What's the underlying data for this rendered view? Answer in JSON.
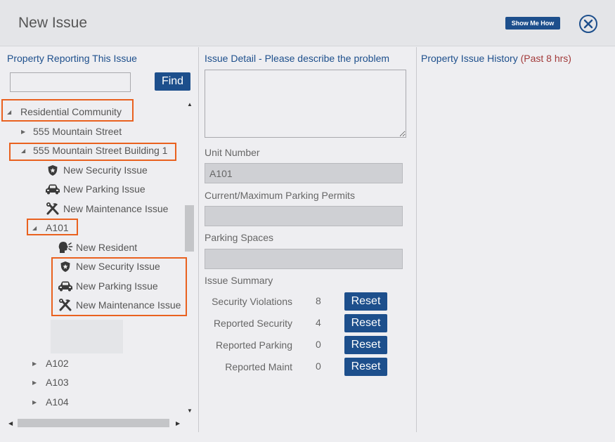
{
  "header": {
    "title": "New Issue",
    "show_me_how": "Show Me How"
  },
  "property_panel": {
    "heading": "Property Reporting This Issue",
    "search_value": "",
    "find_label": "Find",
    "tree": {
      "community": "Residential Community",
      "street": "555 Mountain Street",
      "building": "555 Mountain Street Building 1",
      "building_new_security": "New Security Issue",
      "building_new_parking": "New Parking Issue",
      "building_new_maintenance": "New Maintenance Issue",
      "unit_a101": "A101",
      "new_resident": "New Resident",
      "unit_new_security": "New Security Issue",
      "unit_new_parking": "New Parking Issue",
      "unit_new_maintenance": "New Maintenance Issue",
      "unit_a102": "A102",
      "unit_a103": "A103",
      "unit_a104": "A104"
    }
  },
  "issue_detail": {
    "heading": "Issue Detail - Please describe the problem",
    "description": "",
    "unit_number_label": "Unit Number",
    "unit_number_value": "A101",
    "permits_label": "Current/Maximum Parking Permits",
    "permits_value": "",
    "spaces_label": "Parking Spaces",
    "spaces_value": "",
    "summary_label": "Issue Summary",
    "summary": [
      {
        "label": "Security Violations",
        "value": "8",
        "reset": "Reset"
      },
      {
        "label": "Reported Security",
        "value": "4",
        "reset": "Reset"
      },
      {
        "label": "Reported Parking",
        "value": "0",
        "reset": "Reset"
      },
      {
        "label": "Reported Maint",
        "value": "0",
        "reset": "Reset"
      }
    ]
  },
  "history": {
    "heading": "Property Issue History",
    "heading_muted": "(Past 8 hrs)"
  },
  "colors": {
    "primary": "#1d4f8c",
    "highlight": "#e9611f",
    "muted_red": "#a23a3a"
  },
  "icons": [
    "close-icon",
    "shield-icon",
    "car-icon",
    "tools-icon",
    "resident-icon"
  ]
}
